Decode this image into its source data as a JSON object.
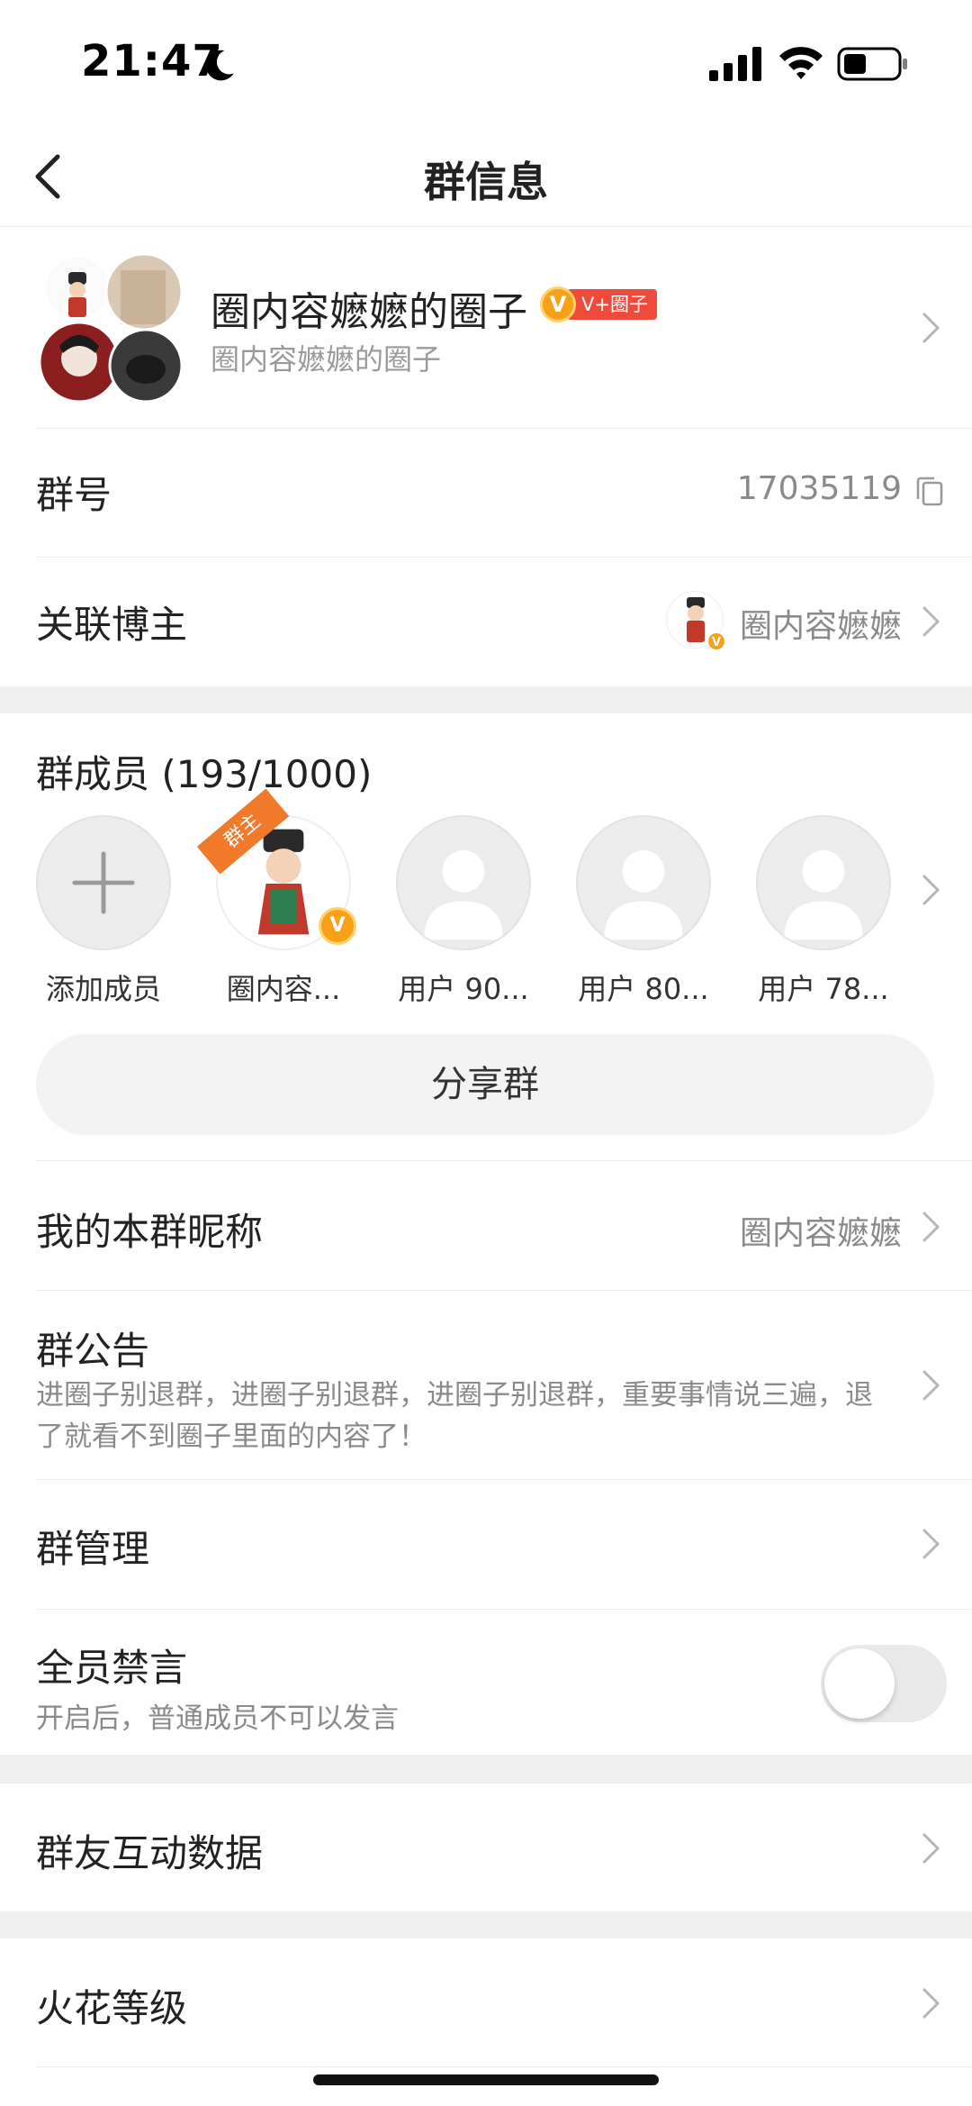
{
  "status_bar": {
    "time": "21:47"
  },
  "nav": {
    "title": "群信息"
  },
  "group": {
    "name": "圈内容嬷嬷的圈子",
    "badge_v": "V",
    "badge_text": "V+圈子",
    "subtitle": "圈内容嬷嬷的圈子"
  },
  "group_number": {
    "label": "群号",
    "value": "17035119"
  },
  "linked_blogger": {
    "label": "关联博主",
    "value": "圈内容嬷嬷",
    "badge_v": "V"
  },
  "members": {
    "title": "群成员 (193/1000)",
    "items": [
      {
        "name": "添加成员"
      },
      {
        "name": "圈内容...",
        "role_tag": "群主",
        "badge_v": "V"
      },
      {
        "name": "用户 90..."
      },
      {
        "name": "用户 80..."
      },
      {
        "name": "用户 78..."
      }
    ],
    "share_label": "分享群"
  },
  "nickname": {
    "label": "我的本群昵称",
    "value": "圈内容嬷嬷"
  },
  "notice": {
    "label": "群公告",
    "text": "进圈子别退群，进圈子别退群，进圈子别退群，重要事情说三遍，退了就看不到圈子里面的内容了！"
  },
  "manage": {
    "label": "群管理"
  },
  "mute_all": {
    "label": "全员禁言",
    "sub": "开启后，普通成员不可以发言",
    "enabled": false
  },
  "interaction": {
    "label": "群友互动数据"
  },
  "spark": {
    "label": "火花等级"
  },
  "colors": {
    "accent_orange": "#f7a11a",
    "badge_red": "#f04b3a",
    "gap_gray": "#f0f0f0"
  }
}
